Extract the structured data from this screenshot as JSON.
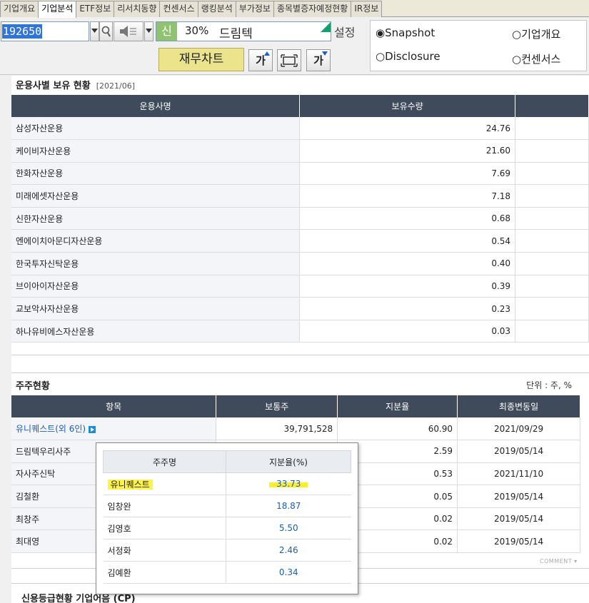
{
  "tabs": [
    "기업개요",
    "기업분석",
    "ETF정보",
    "리서치동향",
    "컨센서스",
    "랭킹분석",
    "부가정보",
    "종목별증자예정현황",
    "IR정보"
  ],
  "active_tab": "기업분석",
  "toolbar": {
    "stock_code": "192650",
    "sin_label": "신",
    "percent": "30%",
    "company_name": "드림텍",
    "setting_label": "설정",
    "financial_chart_button": "재무차트",
    "font_up_label": "가",
    "font_down_label": "가",
    "radios": {
      "snapshot": "Snapshot",
      "company_overview": "기업개요",
      "disclosure": "Disclosure",
      "consensus": "컨센서스"
    },
    "selected_radio": "snapshot"
  },
  "fund_section": {
    "title": "운용사별 보유 현황",
    "date": "[2021/06]",
    "columns": [
      "운용사명",
      "보유수량"
    ],
    "rows": [
      {
        "name": "삼성자산운용",
        "value": "24.76"
      },
      {
        "name": "케이비자산운용",
        "value": "21.60"
      },
      {
        "name": "한화자산운용",
        "value": "7.69"
      },
      {
        "name": "미래에셋자산운용",
        "value": "7.18"
      },
      {
        "name": "신한자산운용",
        "value": "0.68"
      },
      {
        "name": "엔에이치아문디자산운용",
        "value": "0.54"
      },
      {
        "name": "한국투자신탁운용",
        "value": "0.40"
      },
      {
        "name": "브이아이자산운용",
        "value": "0.39"
      },
      {
        "name": "교보악사자산운용",
        "value": "0.23"
      },
      {
        "name": "하나유비에스자산운용",
        "value": "0.03"
      }
    ]
  },
  "shareholder_section": {
    "title": "주주현황",
    "unit": "단위 : 주, %",
    "columns": [
      "항목",
      "보통주",
      "지분율",
      "최종변동일"
    ],
    "rows": [
      {
        "name": "유니퀘스트(외 6인)",
        "shares": "39,791,528",
        "ratio": "60.90",
        "date": "2021/09/29"
      },
      {
        "name": "드림텍우리사주",
        "shares": "",
        "ratio": "2.59",
        "date": "2019/05/14"
      },
      {
        "name": "자사주신탁",
        "shares": "",
        "ratio": "0.53",
        "date": "2021/11/10"
      },
      {
        "name": "김철환",
        "shares": "",
        "ratio": "0.05",
        "date": "2019/05/14"
      },
      {
        "name": "최창주",
        "shares": "",
        "ratio": "0.02",
        "date": "2019/05/14"
      },
      {
        "name": "최대영",
        "shares": "",
        "ratio": "0.02",
        "date": "2019/05/14"
      }
    ],
    "comment_label": "COMMENT"
  },
  "popup": {
    "columns": [
      "주주명",
      "지분율(%)"
    ],
    "rows": [
      {
        "name": "유니퀘스트",
        "value": "33.73"
      },
      {
        "name": "임창완",
        "value": "18.87"
      },
      {
        "name": "김영호",
        "value": "5.50"
      },
      {
        "name": "서정화",
        "value": "2.46"
      },
      {
        "name": "김예환",
        "value": "0.34"
      }
    ]
  },
  "credit_section": {
    "title": "신용등급현황 기업어음 (CP)"
  }
}
